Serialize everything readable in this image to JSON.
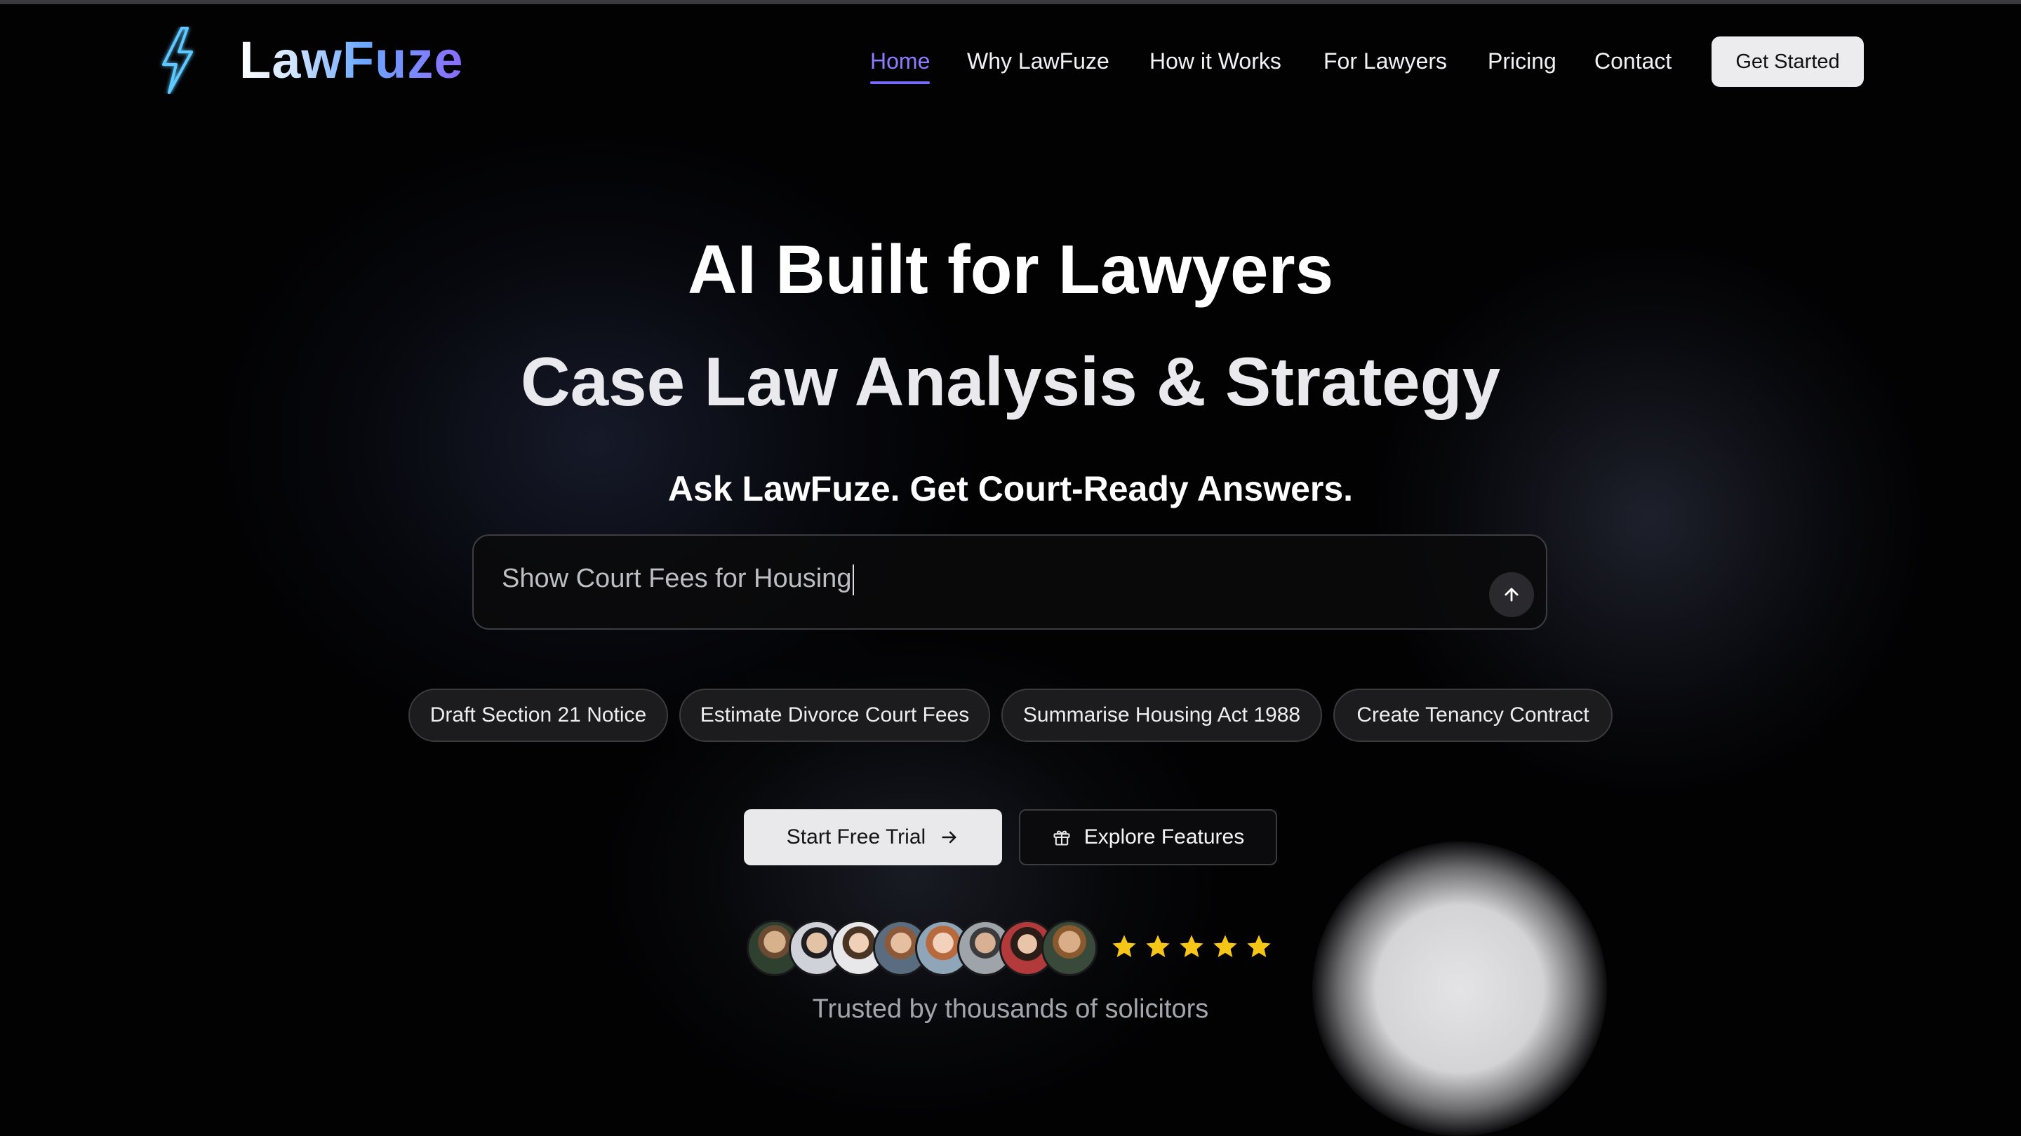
{
  "brand": {
    "name": "LawFuze",
    "icon": "lightning-bolt-icon"
  },
  "nav": {
    "items": [
      {
        "label": "Home",
        "active": true
      },
      {
        "label": "Why LawFuze",
        "active": false
      },
      {
        "label": "How it Works",
        "active": false
      },
      {
        "label": "For Lawyers",
        "active": false
      },
      {
        "label": "Pricing",
        "active": false
      },
      {
        "label": "Contact",
        "active": false
      }
    ],
    "cta_label": "Get Started"
  },
  "hero": {
    "title": "AI Built for Lawyers",
    "subtitle": "Case Law Analysis & Strategy",
    "tagline": "Ask LawFuze. Get Court-Ready Answers."
  },
  "search": {
    "value": "Show Court Fees for Housing",
    "send_icon": "arrow-up-icon"
  },
  "suggestions": [
    "Draft Section 21 Notice",
    "Estimate Divorce Court Fees",
    "Summarise Housing Act 1988",
    "Create Tenancy Contract"
  ],
  "actions": {
    "trial_label": "Start Free Trial",
    "trial_icon": "arrow-right-icon",
    "explore_label": "Explore Features",
    "explore_icon": "gift-icon"
  },
  "social_proof": {
    "avatar_count": 8,
    "rating": 5,
    "rating_max": 5,
    "text": "Trusted by thousands of solicitors"
  },
  "colors": {
    "background": "#020203",
    "accent": "#7a6bff",
    "star": "#f5c518",
    "logo_gradient": [
      "#ffffff",
      "#6ba8ff",
      "#8a6bff"
    ]
  }
}
